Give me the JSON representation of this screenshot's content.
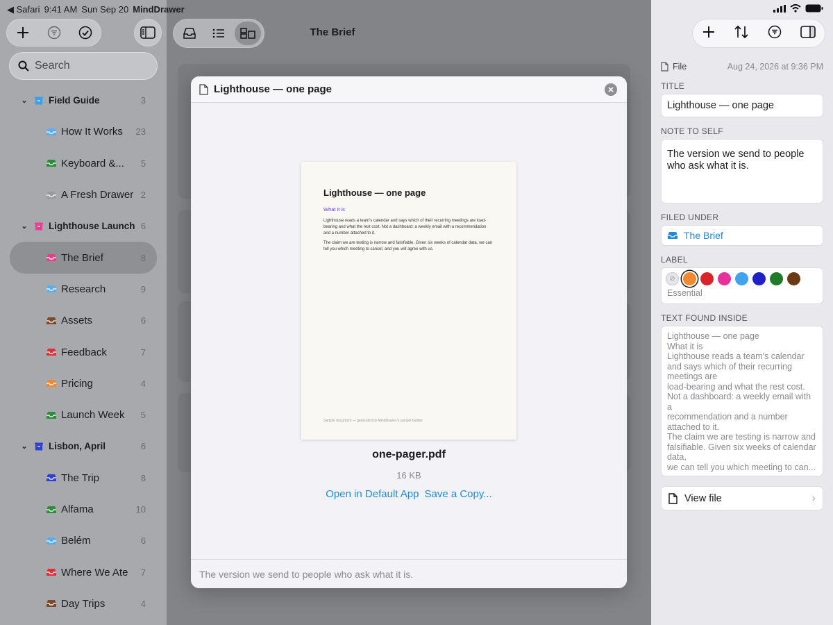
{
  "status": {
    "back_app": "Safari",
    "time": "9:41 AM",
    "date": "Sun Sep 20",
    "app": "MindDrawer"
  },
  "sidebar": {
    "search_placeholder": "Search",
    "groups": [
      {
        "label": "Field Guide",
        "count": "3",
        "color": "#3b9ff0",
        "children": [
          {
            "label": "How It Works",
            "count": "23",
            "color": "#5aaef0"
          },
          {
            "label": "Keyboard &...",
            "count": "5",
            "color": "#2e8b3a"
          },
          {
            "label": "A Fresh Drawer",
            "count": "2",
            "color": "#9a9a9e"
          }
        ]
      },
      {
        "label": "Lighthouse Launch",
        "count": "6",
        "color": "#e83e8c",
        "children": [
          {
            "label": "The Brief",
            "count": "8",
            "color": "#e83e8c",
            "selected": true
          },
          {
            "label": "Research",
            "count": "9",
            "color": "#5aaef0"
          },
          {
            "label": "Assets",
            "count": "6",
            "color": "#7a4a2a"
          },
          {
            "label": "Feedback",
            "count": "7",
            "color": "#d9323a"
          },
          {
            "label": "Pricing",
            "count": "4",
            "color": "#f08a30"
          },
          {
            "label": "Launch Week",
            "count": "5",
            "color": "#2e8b3a"
          }
        ]
      },
      {
        "label": "Lisbon, April",
        "count": "6",
        "color": "#2f3fd0",
        "children": [
          {
            "label": "The Trip",
            "count": "8",
            "color": "#2f3fd0"
          },
          {
            "label": "Alfama",
            "count": "10",
            "color": "#2e8b3a"
          },
          {
            "label": "Belém",
            "count": "6",
            "color": "#5aaef0"
          },
          {
            "label": "Where We Ate",
            "count": "7",
            "color": "#d9323a"
          },
          {
            "label": "Day Trips",
            "count": "4",
            "color": "#7a4a2a"
          }
        ]
      }
    ]
  },
  "middle": {
    "title": "The Brief"
  },
  "modal": {
    "title": "Lighthouse — one page",
    "doc": {
      "heading": "Lighthouse — one page",
      "subheading": "What it is",
      "p1": "Lighthouse reads a team's calendar and says which of their recurring meetings are load-bearing and what the rest cost. Not a dashboard: a weekly email with a recommendation and a number attached to it.",
      "p2": "The claim we are testing is narrow and falsifiable. Given six weeks of calendar data, we can tell you which meeting to cancel, and you will agree with us.",
      "footer": "Sample document — generated by MindDrawer's sample builder"
    },
    "filename": "one-pager.pdf",
    "size": "16 KB",
    "open_label": "Open in Default App",
    "save_label": "Save a Copy...",
    "note": "The version we send to people who ask what it is."
  },
  "inspector": {
    "kind": "File",
    "date": "Aug 24, 2026 at 9:36 PM",
    "title_label": "TITLE",
    "title_value": "Lighthouse — one page",
    "note_label": "NOTE TO SELF",
    "note_value": "The version we send to people who ask what it is.",
    "filed_label": "FILED UNDER",
    "filed_value": "The Brief",
    "label_label": "LABEL",
    "label_colors": [
      "#f08a30",
      "#d9232a",
      "#e8309a",
      "#3fa3f0",
      "#2020c8",
      "#1f7a2a",
      "#6b3a14"
    ],
    "label_selected_index": 0,
    "label_name": "Essential",
    "found_label": "TEXT FOUND INSIDE",
    "found_text": "Lighthouse — one page\nWhat it is\nLighthouse reads a team's calendar and says which of their recurring meetings are\nload-bearing and what the rest cost.\nNot a dashboard: a weekly email with a\nrecommendation and a number attached to it.\nThe claim we are testing is narrow and falsifiable. Given six weeks of calendar data,\nwe can tell you which meeting to can...",
    "view_file": "View file"
  }
}
